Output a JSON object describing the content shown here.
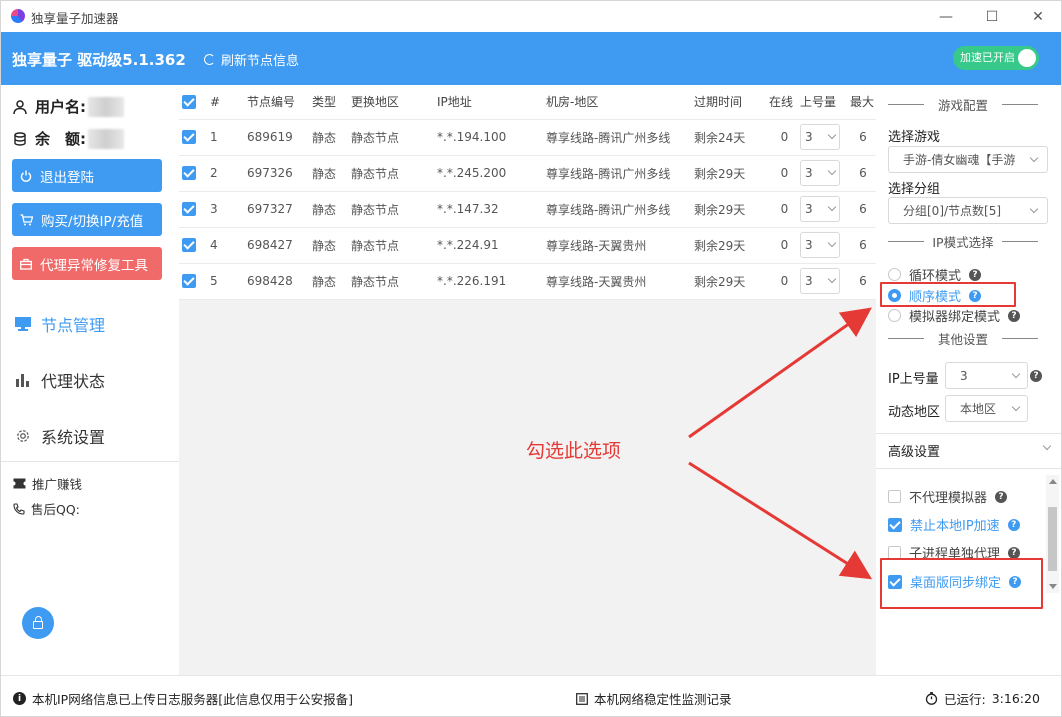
{
  "window": {
    "title": "独享量子加速器",
    "controls": {
      "minimize": "—",
      "maximize": "☐",
      "close": "✕"
    }
  },
  "header": {
    "app_name": "独享量子 驱动级5.1.362",
    "refresh_label": "刷新节点信息",
    "accel_label": "加速已开启"
  },
  "account": {
    "username_label": "用户名:",
    "balance_label": "余　额:"
  },
  "sidebar": {
    "buttons": [
      "退出登陆",
      "购买/切换IP/充值",
      "代理异常修复工具"
    ],
    "nav": [
      "节点管理",
      "代理状态",
      "系统设置"
    ],
    "links": [
      "推广赚钱",
      "售后QQ:"
    ]
  },
  "table": {
    "columns": [
      "#",
      "节点编号",
      "类型",
      "更换地区",
      "IP地址",
      "机房-地区",
      "过期时间",
      "在线",
      "上号量",
      "最大"
    ],
    "rows": [
      {
        "n": "1",
        "id": "689619",
        "type": "静态",
        "region": "静态节点",
        "ip": "*.*.194.100",
        "room": "尊享线路-腾讯广州多线",
        "expire": "剩余24天",
        "online": "0",
        "qty": "3",
        "max": "6"
      },
      {
        "n": "2",
        "id": "697326",
        "type": "静态",
        "region": "静态节点",
        "ip": "*.*.245.200",
        "room": "尊享线路-腾讯广州多线",
        "expire": "剩余29天",
        "online": "0",
        "qty": "3",
        "max": "6"
      },
      {
        "n": "3",
        "id": "697327",
        "type": "静态",
        "region": "静态节点",
        "ip": "*.*.147.32",
        "room": "尊享线路-腾讯广州多线",
        "expire": "剩余29天",
        "online": "0",
        "qty": "3",
        "max": "6"
      },
      {
        "n": "4",
        "id": "698427",
        "type": "静态",
        "region": "静态节点",
        "ip": "*.*.224.91",
        "room": "尊享线路-天翼贵州",
        "expire": "剩余29天",
        "online": "0",
        "qty": "3",
        "max": "6"
      },
      {
        "n": "5",
        "id": "698428",
        "type": "静态",
        "region": "静态节点",
        "ip": "*.*.226.191",
        "room": "尊享线路-天翼贵州",
        "expire": "剩余29天",
        "online": "0",
        "qty": "3",
        "max": "6"
      }
    ]
  },
  "right": {
    "game_section": "游戏配置",
    "select_game_label": "选择游戏",
    "select_game_value": "手游-倩女幽魂【手游",
    "select_group_label": "选择分组",
    "select_group_value": "分组[0]/节点数[5]",
    "ip_mode_section": "IP模式选择",
    "modes": [
      "循环模式",
      "顺序模式",
      "模拟器绑定模式"
    ],
    "other_section": "其他设置",
    "ip_qty_label": "IP上号量",
    "ip_qty_value": "3",
    "dyn_region_label": "动态地区",
    "dyn_region_value": "本地区",
    "advanced_label": "高级设置",
    "options": [
      "不代理模拟器",
      "禁止本地IP加速",
      "子进程单独代理",
      "桌面版同步绑定"
    ]
  },
  "annotation": "勾选此选项",
  "status": {
    "left": "本机IP网络信息已上传日志服务器[此信息仅用于公安报备]",
    "middle": "本机网络稳定性监测记录",
    "right_label": "已运行:",
    "right_value": "3:16:20"
  },
  "colors": {
    "accent": "#3f9bf2",
    "danger": "#f06a6a",
    "toggle_on": "#36c98a",
    "annotation": "#e53935"
  }
}
